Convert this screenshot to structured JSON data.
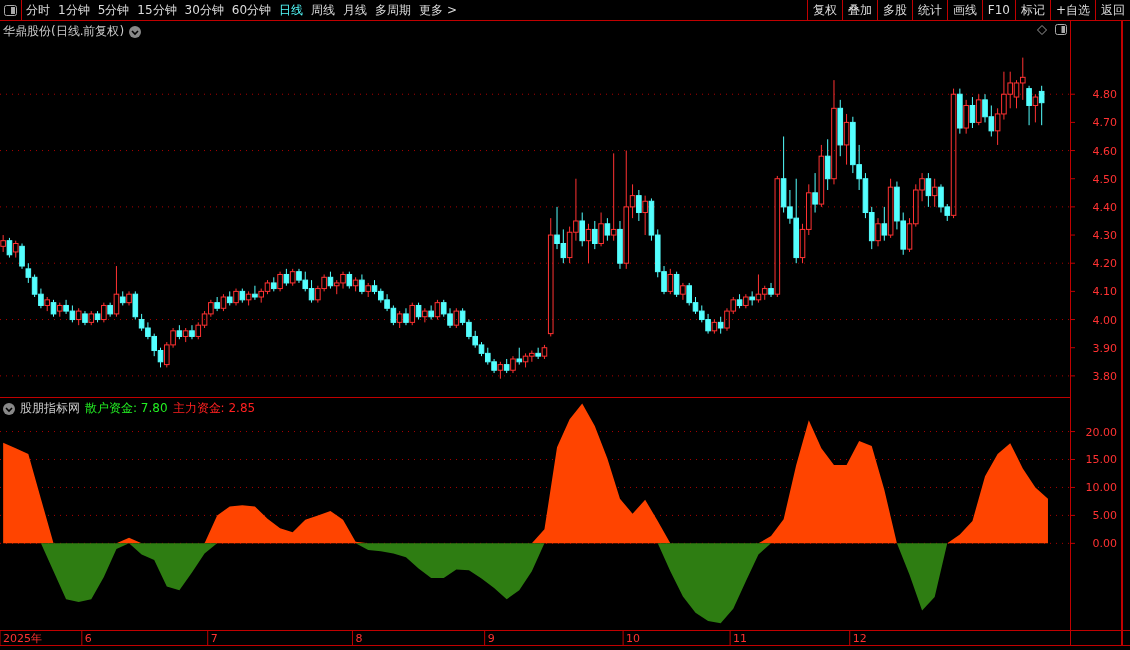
{
  "toolbar": {
    "periods": [
      {
        "label": "分时",
        "selected": false
      },
      {
        "label": "1分钟",
        "selected": false
      },
      {
        "label": "5分钟",
        "selected": false
      },
      {
        "label": "15分钟",
        "selected": false
      },
      {
        "label": "30分钟",
        "selected": false
      },
      {
        "label": "60分钟",
        "selected": false
      },
      {
        "label": "日线",
        "selected": true
      },
      {
        "label": "周线",
        "selected": false
      },
      {
        "label": "月线",
        "selected": false
      },
      {
        "label": "多周期",
        "selected": false
      },
      {
        "label": "更多 >",
        "selected": false
      }
    ],
    "buttons": [
      "复权",
      "叠加",
      "多股",
      "统计",
      "画线",
      "F10",
      "标记",
      "+自选",
      "返回"
    ]
  },
  "price_panel": {
    "title": "华鼎股份(日线.前复权)",
    "chart_data": {
      "type": "candlestick",
      "ylim": [
        3.725,
        5.06
      ],
      "grid": true,
      "yticks": [
        {
          "value": 3.8,
          "label": "3.80"
        },
        {
          "value": 3.9,
          "label": "3.90"
        },
        {
          "value": 4.0,
          "label": "4.00"
        },
        {
          "value": 4.1,
          "label": "4.10"
        },
        {
          "value": 4.2,
          "label": "4.20"
        },
        {
          "value": 4.3,
          "label": "4.30"
        },
        {
          "value": 4.4,
          "label": "4.40"
        },
        {
          "value": 4.5,
          "label": "4.50"
        },
        {
          "value": 4.6,
          "label": "4.60"
        },
        {
          "value": 4.7,
          "label": "4.70"
        },
        {
          "value": 4.8,
          "label": "4.80"
        }
      ],
      "ohlc": [
        [
          4.26,
          4.3,
          4.24,
          4.28
        ],
        [
          4.28,
          4.29,
          4.22,
          4.23
        ],
        [
          4.24,
          4.28,
          4.22,
          4.27
        ],
        [
          4.26,
          4.27,
          4.18,
          4.19
        ],
        [
          4.18,
          4.2,
          4.13,
          4.15
        ],
        [
          4.15,
          4.16,
          4.08,
          4.09
        ],
        [
          4.09,
          4.11,
          4.04,
          4.05
        ],
        [
          4.05,
          4.08,
          4.03,
          4.07
        ],
        [
          4.06,
          4.07,
          4.01,
          4.02
        ],
        [
          4.03,
          4.06,
          4.01,
          4.05
        ],
        [
          4.05,
          4.07,
          4.02,
          4.03
        ],
        [
          4.03,
          4.05,
          3.99,
          4.0
        ],
        [
          4.0,
          4.04,
          3.98,
          4.03
        ],
        [
          4.02,
          4.03,
          3.98,
          3.99
        ],
        [
          3.99,
          4.03,
          3.98,
          4.02
        ],
        [
          4.02,
          4.03,
          3.99,
          4.0
        ],
        [
          4.0,
          4.06,
          3.99,
          4.05
        ],
        [
          4.05,
          4.06,
          4.01,
          4.02
        ],
        [
          4.02,
          4.19,
          4.01,
          4.09
        ],
        [
          4.08,
          4.1,
          4.05,
          4.06
        ],
        [
          4.06,
          4.1,
          4.05,
          4.09
        ],
        [
          4.09,
          4.1,
          4.0,
          4.01
        ],
        [
          4.0,
          4.02,
          3.96,
          3.97
        ],
        [
          3.97,
          3.99,
          3.93,
          3.94
        ],
        [
          3.94,
          3.95,
          3.87,
          3.89
        ],
        [
          3.89,
          3.9,
          3.83,
          3.85
        ],
        [
          3.84,
          3.92,
          3.83,
          3.91
        ],
        [
          3.91,
          3.97,
          3.9,
          3.96
        ],
        [
          3.96,
          3.98,
          3.93,
          3.94
        ],
        [
          3.94,
          3.97,
          3.92,
          3.96
        ],
        [
          3.96,
          3.98,
          3.93,
          3.94
        ],
        [
          3.94,
          3.99,
          3.93,
          3.98
        ],
        [
          3.98,
          4.03,
          3.97,
          4.02
        ],
        [
          4.02,
          4.07,
          4.01,
          4.06
        ],
        [
          4.06,
          4.08,
          4.03,
          4.04
        ],
        [
          4.04,
          4.09,
          4.03,
          4.08
        ],
        [
          4.08,
          4.1,
          4.05,
          4.06
        ],
        [
          4.06,
          4.11,
          4.05,
          4.1
        ],
        [
          4.1,
          4.11,
          4.06,
          4.07
        ],
        [
          4.07,
          4.1,
          4.05,
          4.09
        ],
        [
          4.09,
          4.12,
          4.07,
          4.08
        ],
        [
          4.08,
          4.11,
          4.06,
          4.1
        ],
        [
          4.1,
          4.14,
          4.09,
          4.13
        ],
        [
          4.13,
          4.15,
          4.1,
          4.11
        ],
        [
          4.11,
          4.17,
          4.1,
          4.16
        ],
        [
          4.16,
          4.18,
          4.12,
          4.13
        ],
        [
          4.13,
          4.18,
          4.12,
          4.17
        ],
        [
          4.17,
          4.18,
          4.13,
          4.14
        ],
        [
          4.14,
          4.17,
          4.1,
          4.11
        ],
        [
          4.11,
          4.14,
          4.06,
          4.07
        ],
        [
          4.07,
          4.12,
          4.06,
          4.11
        ],
        [
          4.11,
          4.16,
          4.1,
          4.15
        ],
        [
          4.15,
          4.17,
          4.11,
          4.12
        ],
        [
          4.12,
          4.14,
          4.09,
          4.13
        ],
        [
          4.13,
          4.17,
          4.11,
          4.16
        ],
        [
          4.16,
          4.17,
          4.11,
          4.12
        ],
        [
          4.12,
          4.15,
          4.1,
          4.14
        ],
        [
          4.14,
          4.16,
          4.09,
          4.1
        ],
        [
          4.1,
          4.13,
          4.08,
          4.12
        ],
        [
          4.12,
          4.14,
          4.09,
          4.1
        ],
        [
          4.1,
          4.11,
          4.06,
          4.07
        ],
        [
          4.07,
          4.09,
          4.03,
          4.04
        ],
        [
          4.04,
          4.05,
          3.98,
          3.99
        ],
        [
          3.99,
          4.03,
          3.97,
          4.02
        ],
        [
          4.02,
          4.04,
          3.98,
          3.99
        ],
        [
          3.99,
          4.06,
          3.98,
          4.05
        ],
        [
          4.05,
          4.06,
          4.0,
          4.01
        ],
        [
          4.01,
          4.04,
          3.99,
          4.03
        ],
        [
          4.03,
          4.05,
          4.0,
          4.01
        ],
        [
          4.01,
          4.07,
          4.0,
          4.06
        ],
        [
          4.06,
          4.07,
          4.01,
          4.02
        ],
        [
          4.02,
          4.04,
          3.97,
          3.98
        ],
        [
          3.98,
          4.04,
          3.97,
          4.03
        ],
        [
          4.03,
          4.04,
          3.98,
          3.99
        ],
        [
          3.99,
          4.0,
          3.93,
          3.94
        ],
        [
          3.94,
          3.96,
          3.9,
          3.91
        ],
        [
          3.91,
          3.92,
          3.87,
          3.88
        ],
        [
          3.88,
          3.9,
          3.84,
          3.85
        ],
        [
          3.85,
          3.86,
          3.81,
          3.82
        ],
        [
          3.82,
          3.85,
          3.79,
          3.84
        ],
        [
          3.84,
          3.86,
          3.81,
          3.82
        ],
        [
          3.82,
          3.87,
          3.81,
          3.86
        ],
        [
          3.86,
          3.9,
          3.84,
          3.85
        ],
        [
          3.85,
          3.88,
          3.83,
          3.87
        ],
        [
          3.87,
          3.89,
          3.85,
          3.88
        ],
        [
          3.88,
          3.9,
          3.86,
          3.87
        ],
        [
          3.87,
          3.91,
          3.86,
          3.9
        ],
        [
          3.95,
          4.36,
          3.94,
          4.3
        ],
        [
          4.3,
          4.4,
          4.25,
          4.27
        ],
        [
          4.27,
          4.32,
          4.2,
          4.22
        ],
        [
          4.22,
          4.33,
          4.2,
          4.31
        ],
        [
          4.31,
          4.5,
          4.28,
          4.35
        ],
        [
          4.35,
          4.38,
          4.26,
          4.28
        ],
        [
          4.28,
          4.34,
          4.2,
          4.32
        ],
        [
          4.32,
          4.35,
          4.25,
          4.27
        ],
        [
          4.27,
          4.38,
          4.26,
          4.34
        ],
        [
          4.34,
          4.36,
          4.28,
          4.3
        ],
        [
          4.3,
          4.59,
          4.28,
          4.32
        ],
        [
          4.32,
          4.35,
          4.18,
          4.2
        ],
        [
          4.2,
          4.6,
          4.18,
          4.4
        ],
        [
          4.4,
          4.48,
          4.36,
          4.44
        ],
        [
          4.44,
          4.46,
          4.35,
          4.38
        ],
        [
          4.38,
          4.44,
          4.3,
          4.42
        ],
        [
          4.42,
          4.43,
          4.28,
          4.3
        ],
        [
          4.3,
          4.32,
          4.15,
          4.17
        ],
        [
          4.17,
          4.19,
          4.09,
          4.1
        ],
        [
          4.1,
          4.18,
          4.09,
          4.16
        ],
        [
          4.16,
          4.17,
          4.08,
          4.09
        ],
        [
          4.09,
          4.13,
          4.07,
          4.12
        ],
        [
          4.12,
          4.13,
          4.05,
          4.06
        ],
        [
          4.06,
          4.08,
          4.02,
          4.03
        ],
        [
          4.03,
          4.05,
          3.99,
          4.0
        ],
        [
          4.0,
          4.02,
          3.95,
          3.96
        ],
        [
          3.96,
          4.0,
          3.95,
          3.99
        ],
        [
          3.99,
          4.01,
          3.95,
          3.97
        ],
        [
          3.97,
          4.04,
          3.96,
          4.03
        ],
        [
          4.03,
          4.08,
          4.02,
          4.07
        ],
        [
          4.07,
          4.09,
          4.04,
          4.05
        ],
        [
          4.05,
          4.09,
          4.04,
          4.08
        ],
        [
          4.08,
          4.1,
          4.05,
          4.07
        ],
        [
          4.07,
          4.16,
          4.06,
          4.09
        ],
        [
          4.09,
          4.12,
          4.07,
          4.11
        ],
        [
          4.11,
          4.13,
          4.08,
          4.09
        ],
        [
          4.09,
          4.51,
          4.08,
          4.5
        ],
        [
          4.5,
          4.65,
          4.38,
          4.4
        ],
        [
          4.4,
          4.46,
          4.34,
          4.36
        ],
        [
          4.36,
          4.5,
          4.2,
          4.22
        ],
        [
          4.22,
          4.34,
          4.2,
          4.32
        ],
        [
          4.32,
          4.48,
          4.3,
          4.45
        ],
        [
          4.45,
          4.52,
          4.38,
          4.41
        ],
        [
          4.41,
          4.62,
          4.4,
          4.58
        ],
        [
          4.58,
          4.64,
          4.46,
          4.5
        ],
        [
          4.5,
          4.85,
          4.48,
          4.75
        ],
        [
          4.75,
          4.78,
          4.58,
          4.62
        ],
        [
          4.62,
          4.73,
          4.55,
          4.7
        ],
        [
          4.7,
          4.72,
          4.52,
          4.55
        ],
        [
          4.55,
          4.62,
          4.46,
          4.5
        ],
        [
          4.5,
          4.52,
          4.36,
          4.38
        ],
        [
          4.38,
          4.4,
          4.25,
          4.28
        ],
        [
          4.28,
          4.36,
          4.26,
          4.34
        ],
        [
          4.34,
          4.4,
          4.28,
          4.3
        ],
        [
          4.3,
          4.5,
          4.29,
          4.47
        ],
        [
          4.47,
          4.49,
          4.32,
          4.35
        ],
        [
          4.35,
          4.38,
          4.23,
          4.25
        ],
        [
          4.25,
          4.36,
          4.24,
          4.34
        ],
        [
          4.34,
          4.48,
          4.33,
          4.46
        ],
        [
          4.46,
          4.52,
          4.42,
          4.5
        ],
        [
          4.5,
          4.52,
          4.4,
          4.44
        ],
        [
          4.44,
          4.5,
          4.4,
          4.47
        ],
        [
          4.47,
          4.48,
          4.38,
          4.4
        ],
        [
          4.4,
          4.41,
          4.35,
          4.37
        ],
        [
          4.37,
          4.82,
          4.36,
          4.8
        ],
        [
          4.8,
          4.82,
          4.66,
          4.68
        ],
        [
          4.68,
          4.78,
          4.66,
          4.76
        ],
        [
          4.76,
          4.79,
          4.68,
          4.7
        ],
        [
          4.7,
          4.8,
          4.69,
          4.78
        ],
        [
          4.78,
          4.8,
          4.7,
          4.72
        ],
        [
          4.72,
          4.76,
          4.65,
          4.67
        ],
        [
          4.67,
          4.75,
          4.62,
          4.73
        ],
        [
          4.73,
          4.88,
          4.71,
          4.8
        ],
        [
          4.8,
          4.88,
          4.75,
          4.84
        ],
        [
          4.79,
          4.85,
          4.75,
          4.84
        ],
        [
          4.84,
          4.93,
          4.78,
          4.86
        ],
        [
          4.82,
          4.83,
          4.69,
          4.76
        ],
        [
          4.76,
          4.8,
          4.7,
          4.79
        ],
        [
          4.81,
          4.83,
          4.69,
          4.77
        ]
      ]
    }
  },
  "indicator_panel": {
    "title": "股朋指标网",
    "legends": [
      {
        "label": "散户资金: 7.80",
        "color": "#22ee22"
      },
      {
        "label": "主力资金: 2.85",
        "color": "#ff2020"
      }
    ],
    "chart_data": {
      "type": "area",
      "ylim": [
        -15.5,
        26
      ],
      "grid": true,
      "yticks": [
        {
          "value": 0,
          "label": "0.00"
        },
        {
          "value": 5,
          "label": "5.00"
        },
        {
          "value": 10,
          "label": "10.00"
        },
        {
          "value": 15,
          "label": "15.00"
        },
        {
          "value": 20,
          "label": "20.00"
        }
      ],
      "categories": [
        null,
        null,
        null,
        null,
        null,
        null,
        null,
        null,
        null,
        null,
        null,
        null,
        null,
        null,
        null,
        null,
        null,
        null,
        null,
        null,
        null,
        null,
        null,
        null,
        null,
        null,
        null,
        null,
        null,
        null,
        null,
        null,
        null,
        null,
        null,
        null,
        null,
        null,
        null,
        null,
        null,
        null,
        null,
        null,
        null,
        null,
        null,
        null,
        null,
        null,
        null,
        null,
        null,
        null,
        null,
        null,
        null,
        null,
        null,
        null,
        null,
        null,
        null,
        null,
        null,
        null,
        null,
        null,
        null,
        null,
        null,
        null,
        null,
        null,
        null,
        null,
        null,
        null,
        null,
        null,
        null,
        null,
        null,
        null
      ],
      "series": [
        {
          "color": "#ff4400",
          "values": [
            18,
            17,
            16,
            8,
            0,
            0,
            0,
            0,
            0,
            0,
            1,
            0,
            0,
            0,
            0,
            0,
            0,
            5,
            6.6,
            6.8,
            6.6,
            4.4,
            2.7,
            2,
            4.2,
            5,
            5.8,
            4.2,
            0.3,
            0,
            0,
            0,
            0,
            0,
            0,
            0,
            0,
            0,
            0,
            0,
            0,
            0,
            0,
            2.5,
            17.2,
            22.2,
            25,
            21,
            15.2,
            8,
            5.3,
            7.8,
            4,
            0,
            0,
            0,
            0,
            0,
            0,
            0,
            0,
            1.3,
            4.3,
            14,
            22,
            17,
            14,
            14,
            18.3,
            17.4,
            9.6,
            0,
            0,
            0,
            0,
            0,
            1.6,
            4,
            12,
            16,
            17.9,
            13.4,
            10,
            8
          ]
        },
        {
          "color": "#2e7d12",
          "values": [
            0,
            0,
            0,
            0,
            -5,
            -10,
            -10.5,
            -10,
            -6,
            -1,
            0,
            -2,
            -3,
            -7.7,
            -8.4,
            -5.2,
            -1.8,
            0,
            0,
            0,
            0,
            0,
            0,
            0,
            0,
            0,
            0,
            0,
            0,
            -1.2,
            -1.4,
            -1.8,
            -2.5,
            -4.5,
            -6.2,
            -6.2,
            -4.7,
            -4.8,
            -6.3,
            -8,
            -10,
            -8.4,
            -5,
            0,
            0,
            0,
            0,
            0,
            0,
            0,
            0,
            0,
            0,
            -5,
            -9.5,
            -12.4,
            -13.9,
            -14.3,
            -11.7,
            -6.8,
            -2,
            0,
            0,
            0,
            0,
            0,
            0,
            0,
            0,
            0,
            0,
            0,
            -5.6,
            -12,
            -9.6,
            0,
            0,
            0,
            0,
            0,
            0,
            0,
            0,
            0
          ]
        }
      ]
    }
  },
  "date_axis": {
    "labels": [
      "2025年",
      "6",
      "7",
      "8",
      "9",
      "10",
      "11",
      "12"
    ]
  }
}
